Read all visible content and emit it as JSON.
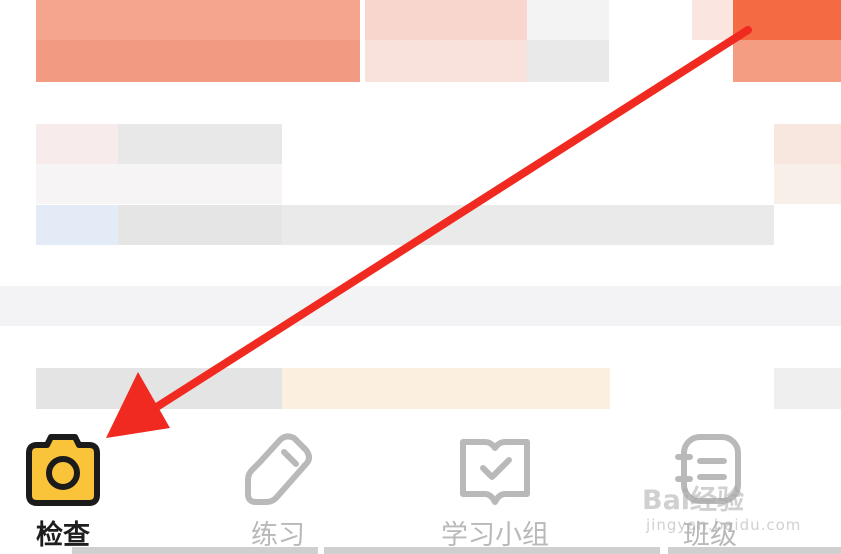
{
  "tabs": [
    {
      "label": "检查",
      "icon": "camera-icon",
      "active": true
    },
    {
      "label": "练习",
      "icon": "pencil-eraser-icon",
      "active": false
    },
    {
      "label": "学习小组",
      "icon": "book-check-icon",
      "active": false
    },
    {
      "label": "班级",
      "icon": "class-notebook-icon",
      "active": false
    }
  ],
  "watermark": {
    "brand": "Bai经验",
    "url": "jingyan.baidu.com"
  },
  "colors": {
    "active_icon_fill": "#f9c33a",
    "active_icon_stroke": "#1b1b1b",
    "inactive_icon": "#b9b9b9",
    "annotation_arrow": "#f02a20"
  }
}
